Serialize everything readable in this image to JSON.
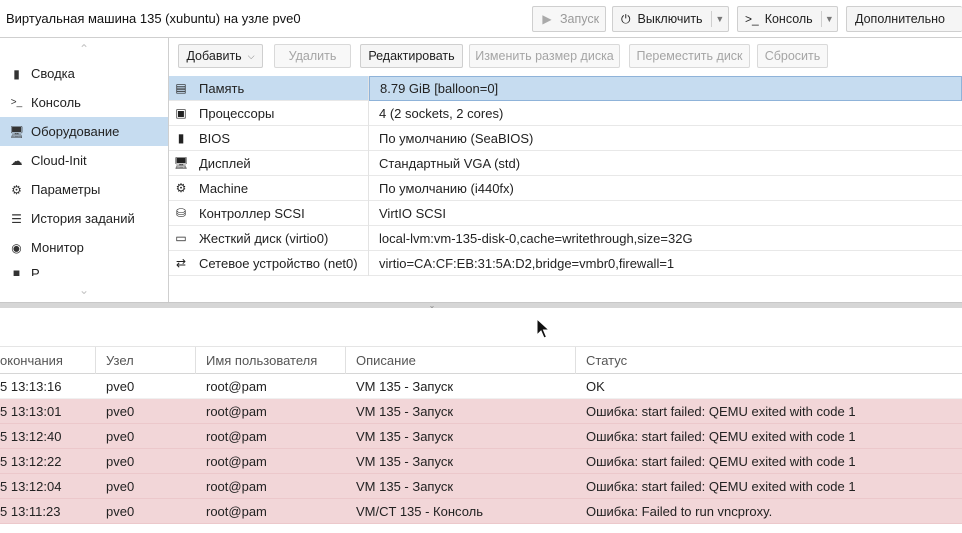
{
  "header": {
    "title": "Виртуальная машина 135 (xubuntu) на узле pve0",
    "start_label": "Запуск",
    "shutdown_label": "Выключить",
    "console_label": "Консоль",
    "more_label": "Дополнительно"
  },
  "nav": {
    "items": [
      {
        "label": "Сводка",
        "icon": "book-icon"
      },
      {
        "label": "Консоль",
        "icon": "terminal-icon"
      },
      {
        "label": "Оборудование",
        "icon": "monitor-icon"
      },
      {
        "label": "Cloud-Init",
        "icon": "cloud-icon"
      },
      {
        "label": "Параметры",
        "icon": "gear-icon"
      },
      {
        "label": "История заданий",
        "icon": "list-icon"
      },
      {
        "label": "Монитор",
        "icon": "eye-icon"
      },
      {
        "label": "Р",
        "icon": "save-icon"
      }
    ],
    "selected": "Оборудование"
  },
  "toolbar": {
    "add_label": "Добавить",
    "delete_label": "Удалить",
    "edit_label": "Редактировать",
    "resize_label": "Изменить размер диска",
    "move_label": "Переместить диск",
    "reset_label": "Сбросить"
  },
  "hardware": [
    {
      "name": "Память",
      "value": "8.79 GiB [balloon=0]",
      "icon": "memory-icon"
    },
    {
      "name": "Процессоры",
      "value": "4 (2 sockets, 2 cores)",
      "icon": "cpu-icon"
    },
    {
      "name": "BIOS",
      "value": "По умолчанию (SeaBIOS)",
      "icon": "chip-icon"
    },
    {
      "name": "Дисплей",
      "value": "Стандартный VGA (std)",
      "icon": "display-icon"
    },
    {
      "name": "Machine",
      "value": "По умолчанию (i440fx)",
      "icon": "cogs-icon"
    },
    {
      "name": "Контроллер SCSI",
      "value": "VirtIO SCSI",
      "icon": "database-icon"
    },
    {
      "name": "Жесткий диск (virtio0)",
      "value": "local-lvm:vm-135-disk-0,cache=writethrough,size=32G",
      "icon": "hdd-icon"
    },
    {
      "name": "Сетевое устройство (net0)",
      "value": "virtio=CA:CF:EB:31:5A:D2,bridge=vmbr0,firewall=1",
      "icon": "network-icon"
    }
  ],
  "tasks": {
    "columns": [
      "окончания",
      "Узел",
      "Имя пользователя",
      "Описание",
      "Статус"
    ],
    "rows": [
      {
        "end": "5 13:13:16",
        "node": "pve0",
        "user": "root@pam",
        "desc": "VM 135 - Запуск",
        "status": "OK",
        "error": false
      },
      {
        "end": "5 13:13:01",
        "node": "pve0",
        "user": "root@pam",
        "desc": "VM 135 - Запуск",
        "status": "Ошибка: start failed: QEMU exited with code 1",
        "error": true
      },
      {
        "end": "5 13:12:40",
        "node": "pve0",
        "user": "root@pam",
        "desc": "VM 135 - Запуск",
        "status": "Ошибка: start failed: QEMU exited with code 1",
        "error": true
      },
      {
        "end": "5 13:12:22",
        "node": "pve0",
        "user": "root@pam",
        "desc": "VM 135 - Запуск",
        "status": "Ошибка: start failed: QEMU exited with code 1",
        "error": true
      },
      {
        "end": "5 13:12:04",
        "node": "pve0",
        "user": "root@pam",
        "desc": "VM 135 - Запуск",
        "status": "Ошибка: start failed: QEMU exited with code 1",
        "error": true
      },
      {
        "end": "5 13:11:23",
        "node": "pve0",
        "user": "root@pam",
        "desc": "VM/CT 135 - Консоль",
        "status": "Ошибка: Failed to run vncproxy.",
        "error": true
      }
    ]
  },
  "colors": {
    "selected_bg": "#c6dcf0",
    "error_row_bg": "#f2d6d8"
  }
}
